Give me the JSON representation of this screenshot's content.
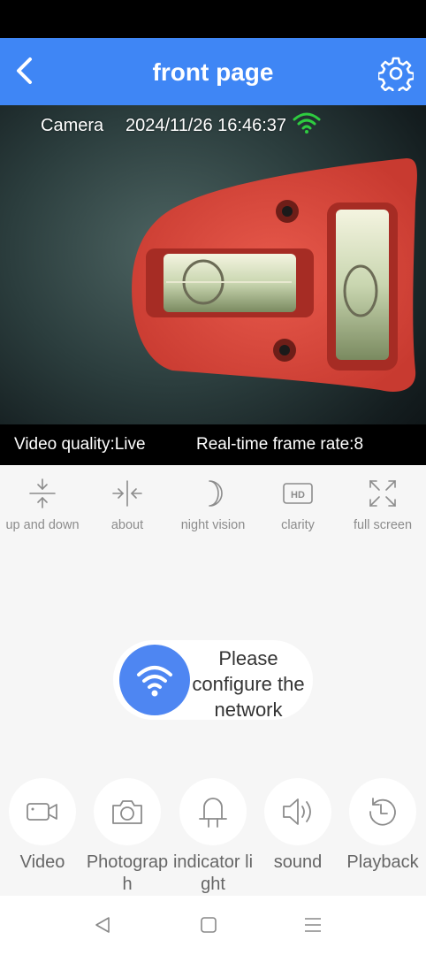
{
  "header": {
    "title": "front page",
    "back_icon": "chevron-left-icon",
    "settings_icon": "gear-icon"
  },
  "video": {
    "camera_label": "Camera",
    "timestamp": "2024/11/26 16:46:37",
    "quality_text": "Video quality:Live",
    "frame_rate_text": "Real-time frame rate:8",
    "wifi_color": "#2ecc40"
  },
  "controls": [
    {
      "label": "up and down",
      "icon": "flip-vertical-icon"
    },
    {
      "label": "about",
      "icon": "flip-horizontal-icon"
    },
    {
      "label": "night vision",
      "icon": "moon-icon"
    },
    {
      "label": "clarity",
      "icon": "hd-icon",
      "badge": "HD"
    },
    {
      "label": "full screen",
      "icon": "fullscreen-icon"
    }
  ],
  "network": {
    "text": "Please configure the network",
    "icon": "wifi-icon",
    "color": "#4e86f2"
  },
  "actions": [
    {
      "label": "Video",
      "icon": "video-camera-icon"
    },
    {
      "label": "Photograph",
      "icon": "camera-icon"
    },
    {
      "label": "indicator light",
      "icon": "light-icon"
    },
    {
      "label": "sound",
      "icon": "speaker-icon"
    },
    {
      "label": "Playback",
      "icon": "history-icon"
    }
  ],
  "colors": {
    "header": "#3f86f5",
    "accent": "#4e86f2",
    "icon_gray": "#8c8c8c"
  }
}
